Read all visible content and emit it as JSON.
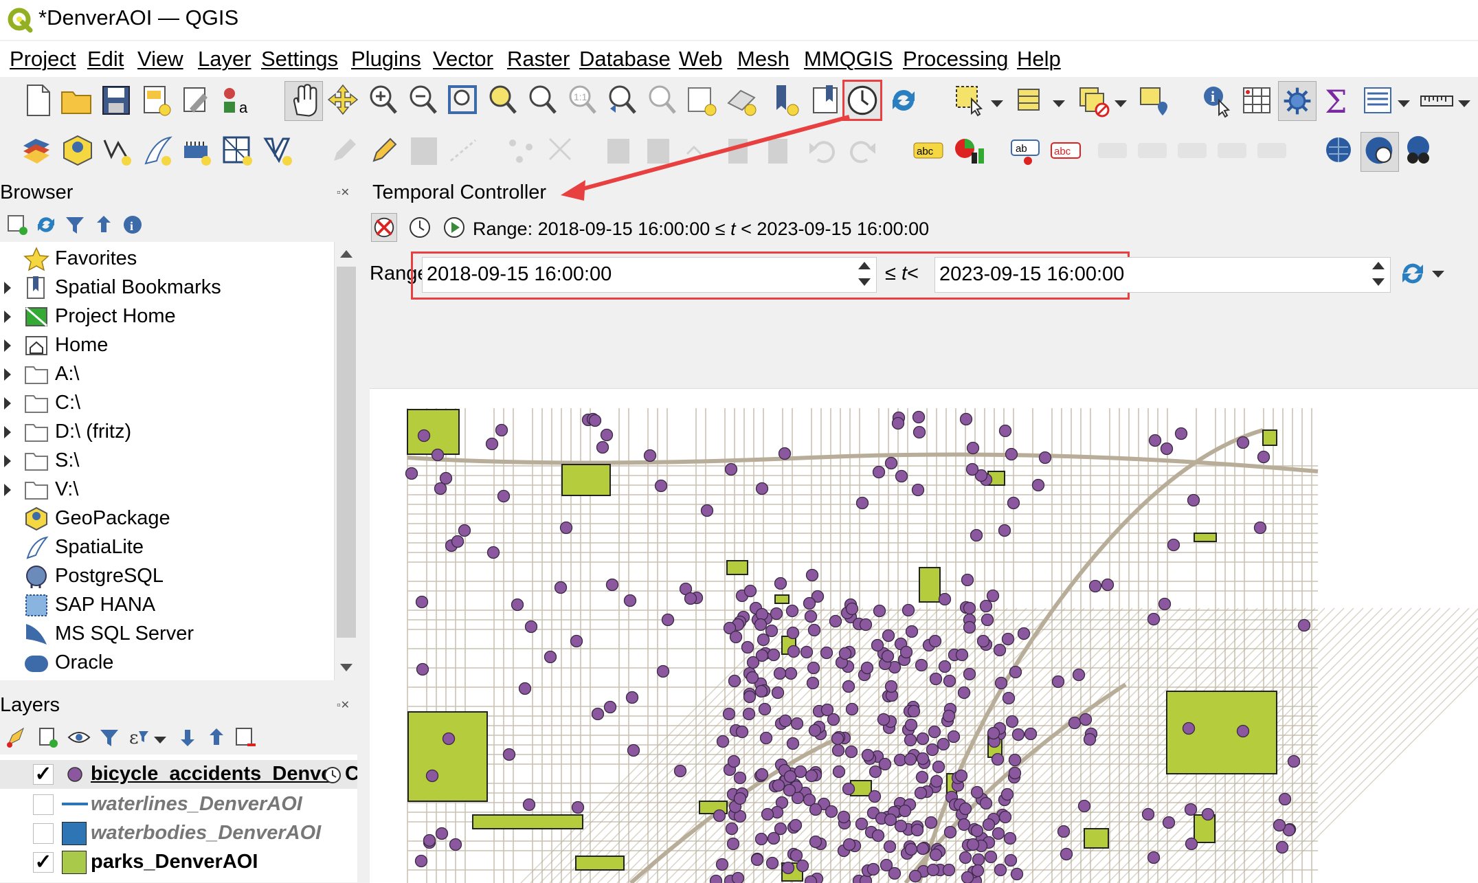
{
  "window": {
    "title": "*DenverAOI — QGIS"
  },
  "menubar": {
    "items": [
      "Project",
      "Edit",
      "View",
      "Layer",
      "Settings",
      "Plugins",
      "Vector",
      "Raster",
      "Database",
      "Web",
      "Mesh",
      "MMQGIS",
      "Processing",
      "Help"
    ]
  },
  "toolbar1": {
    "icons": [
      "new-project-icon",
      "open-project-icon",
      "save-project-icon",
      "new-print-layout-icon",
      "style-manager-icon",
      "python-console-icon",
      "pan-map-icon",
      "pan-to-selection-icon",
      "zoom-in-icon",
      "zoom-out-icon",
      "zoom-full-icon",
      "zoom-to-selection-icon",
      "zoom-to-layer-icon",
      "zoom-native-icon",
      "zoom-last-icon",
      "zoom-next-icon",
      "new-map-view-icon",
      "new-3d-map-view-icon",
      "new-bookmark-icon",
      "show-bookmarks-icon",
      "temporal-controller-icon",
      "refresh-icon",
      "select-features-icon",
      "open-attribute-table-icon",
      "deselect-features-icon",
      "select-by-location-icon",
      "identify-features-icon",
      "attribute-table-icon",
      "toolbox-icon",
      "statistics-icon",
      "layer-attributes-icon",
      "measure-line-icon"
    ]
  },
  "toolbar2": {
    "icons": [
      "data-source-manager-icon",
      "new-geopackage-layer-icon",
      "new-shapefile-layer-icon",
      "new-spatialite-layer-icon",
      "new-virtual-layer-icon",
      "new-temporary-layer-icon",
      "digitize-icon"
    ]
  },
  "browser": {
    "title": "Browser",
    "items": [
      {
        "label": "Favorites",
        "icon": "star-icon",
        "expandable": false
      },
      {
        "label": "Spatial Bookmarks",
        "icon": "bookmark-icon",
        "expandable": true
      },
      {
        "label": "Project Home",
        "icon": "project-home-icon",
        "expandable": true
      },
      {
        "label": "Home",
        "icon": "home-icon",
        "expandable": true
      },
      {
        "label": "A:\\",
        "icon": "folder-icon",
        "expandable": true
      },
      {
        "label": "C:\\",
        "icon": "folder-icon",
        "expandable": true
      },
      {
        "label": "D:\\ (fritz)",
        "icon": "folder-icon",
        "expandable": true
      },
      {
        "label": "S:\\",
        "icon": "folder-icon",
        "expandable": true
      },
      {
        "label": "V:\\",
        "icon": "folder-icon",
        "expandable": true
      },
      {
        "label": "GeoPackage",
        "icon": "geopackage-icon",
        "expandable": false
      },
      {
        "label": "SpatiaLite",
        "icon": "spatialite-icon",
        "expandable": false
      },
      {
        "label": "PostgreSQL",
        "icon": "postgresql-icon",
        "expandable": false
      },
      {
        "label": "SAP HANA",
        "icon": "sap-hana-icon",
        "expandable": false
      },
      {
        "label": "MS SQL Server",
        "icon": "mssql-icon",
        "expandable": false
      },
      {
        "label": "Oracle",
        "icon": "oracle-icon",
        "expandable": false
      }
    ]
  },
  "layers": {
    "title": "Layers",
    "items": [
      {
        "label": "bicycle_accidents_Denve",
        "checked": true,
        "color": "#8b4f9e",
        "symbol": "point"
      },
      {
        "label": "waterlines_DenverAOI",
        "checked": false,
        "color": "#2e75b6",
        "symbol": "line"
      },
      {
        "label": "waterbodies_DenverAOI",
        "checked": false,
        "color": "#2e75b6",
        "symbol": "fill"
      },
      {
        "label": "parks_DenverAOI",
        "checked": true,
        "color": "#a8c94a",
        "symbol": "fill"
      }
    ]
  },
  "temporal": {
    "title": "Temporal Controller",
    "status_prefix": "Range: ",
    "status_range_start": "2018-09-15 16:00:00 ≤ ",
    "status_t": "t",
    "status_range_end": " < 2023-09-15 16:00:00",
    "range_label": "Range",
    "start": "2018-09-15 16:00:00",
    "end": "2023-09-15 16:00:00",
    "op_le": "≤",
    "op_t": "t",
    "op_lt": "<"
  },
  "colors": {
    "accent_red": "#e84040",
    "park_fill": "#b5cc3c",
    "accident_point": "#8b579e",
    "road": "#b8ad98"
  }
}
